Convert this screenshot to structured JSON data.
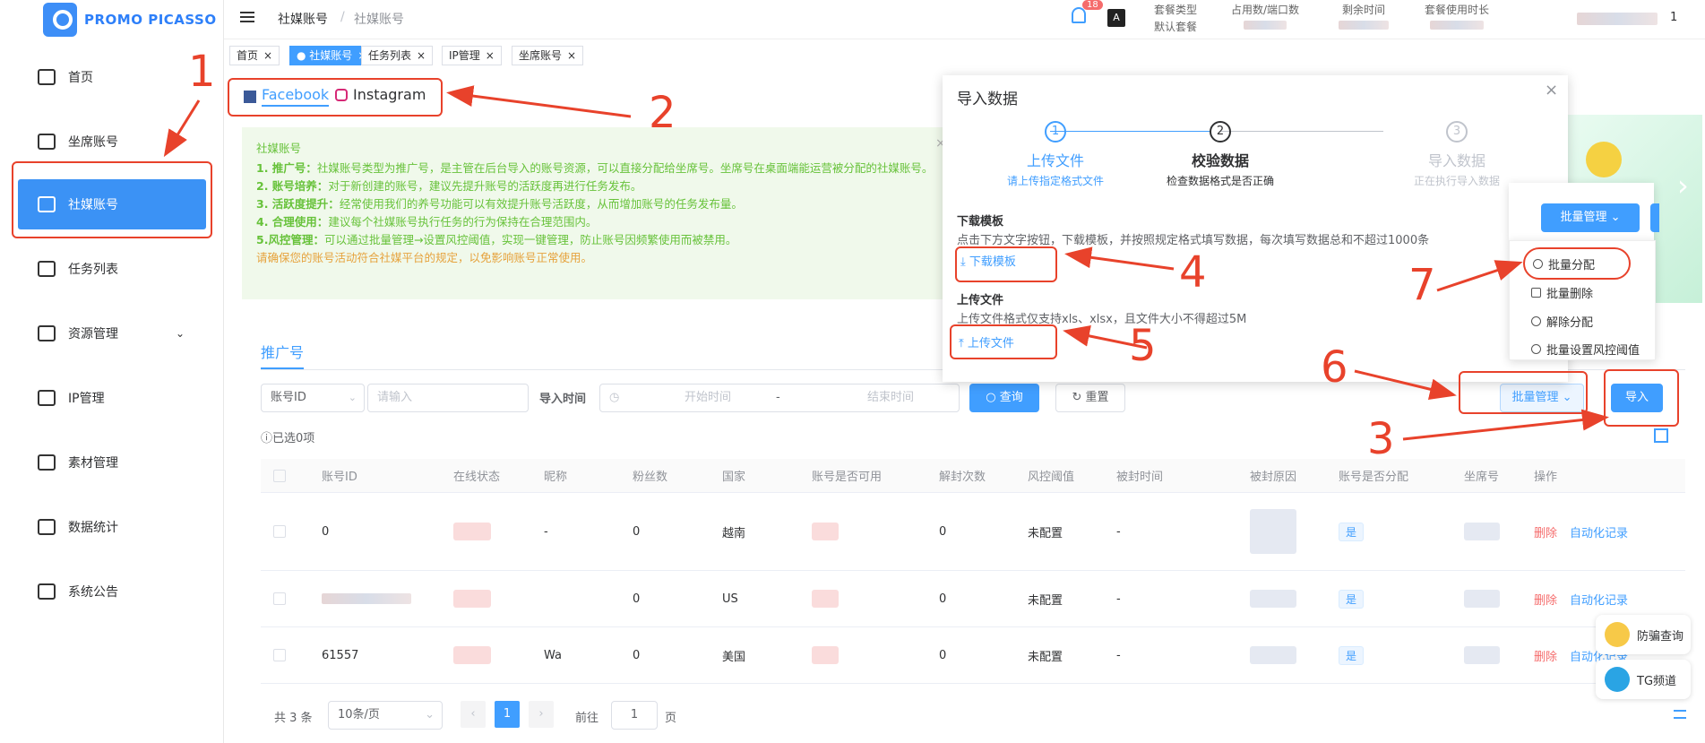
{
  "app": {
    "name": "PROMO PICASSO"
  },
  "sidebar": {
    "items": [
      {
        "label": "首页",
        "icon": "home-icon"
      },
      {
        "label": "坐席账号",
        "icon": "seat-icon"
      },
      {
        "label": "社媒账号",
        "icon": "user-list-icon",
        "active": true
      },
      {
        "label": "任务列表",
        "icon": "task-icon"
      },
      {
        "label": "资源管理",
        "icon": "layers-icon",
        "expandable": true
      },
      {
        "label": "IP管理",
        "icon": "ip-icon"
      },
      {
        "label": "素材管理",
        "icon": "image-icon"
      },
      {
        "label": "数据统计",
        "icon": "chart-icon"
      },
      {
        "label": "系统公告",
        "icon": "bell-icon"
      }
    ]
  },
  "header": {
    "breadcrumb": [
      "社媒账号",
      "社媒账号"
    ],
    "notification_count": "18",
    "info": [
      {
        "label": "套餐类型",
        "value": "默认套餐"
      },
      {
        "label": "占用数/端口数",
        "value": ""
      },
      {
        "label": "剩余时间",
        "value": ""
      },
      {
        "label": "套餐使用时长",
        "value": ""
      }
    ],
    "page_number": "1"
  },
  "tabs": [
    {
      "label": "首页"
    },
    {
      "label": "社媒账号",
      "active": true
    },
    {
      "label": "任务列表"
    },
    {
      "label": "IP管理"
    },
    {
      "label": "坐席账号"
    }
  ],
  "platforms": [
    "Facebook",
    "Instagram"
  ],
  "notice": {
    "title": "社媒账号",
    "lines": [
      {
        "key": "1. 推广号：",
        "text": "社媒账号类型为推广号，是主管在后台导入的账号资源，可以直接分配给坐席号。坐席号在桌面端能运营被分配的社媒账号。"
      },
      {
        "key": "2. 账号培养：",
        "text": "对于新创建的账号，建议先提升账号的活跃度再进行任务发布。"
      },
      {
        "key": "3. 活跃度提升：",
        "text": "经常使用我们的养号功能可以有效提升账号活跃度，从而增加账号的任务发布量。"
      },
      {
        "key": "4. 合理使用：",
        "text": "建议每个社媒账号执行任务的行为保持在合理范围内。"
      },
      {
        "key": "5.风控管理：",
        "text": "可以通过批量管理→设置风控阈值，实现一键管理，防止账号因频繁使用而被禁用。"
      }
    ],
    "warning": "请确保您的账号活动符合社媒平台的规定，以免影响账号正常使用。"
  },
  "subtab": "推广号",
  "filters": {
    "field_select": "账号ID",
    "search_placeholder": "请输入",
    "import_time_label": "导入时间",
    "start_placeholder": "开始时间",
    "range_sep": "-",
    "end_placeholder": "结束时间",
    "query": "查询",
    "reset": "重置",
    "batch": "批量管理",
    "import": "导入",
    "selected": "已选0项"
  },
  "table": {
    "columns": [
      "账号ID",
      "在线状态",
      "昵称",
      "粉丝数",
      "国家",
      "账号是否可用",
      "解封次数",
      "风控阈值",
      "被封时间",
      "被封原因",
      "账号是否分配",
      "坐席号",
      "操作"
    ],
    "rows": [
      {
        "id": "0",
        "nickname": "-",
        "fans": "0",
        "country": "越南",
        "unban": "0",
        "risk": "未配置",
        "ban_time": "-",
        "assigned": "是",
        "delete": "删除",
        "record": "自动化记录"
      },
      {
        "id": "",
        "nickname": "",
        "fans": "0",
        "country": "US",
        "unban": "0",
        "risk": "未配置",
        "ban_time": "-",
        "assigned": "是",
        "delete": "删除",
        "record": "自动化记录"
      },
      {
        "id": "61557",
        "nickname": "Wa",
        "fans": "0",
        "country": "美国",
        "unban": "0",
        "risk": "未配置",
        "ban_time": "-",
        "assigned": "是",
        "delete": "删除",
        "record": "自动化记录"
      }
    ]
  },
  "pagination": {
    "total": "共 3 条",
    "size": "10条/页",
    "current": "1",
    "goto": "前往",
    "goto_value": "1",
    "unit": "页"
  },
  "dialog": {
    "title": "导入数据",
    "steps": [
      {
        "num": "1",
        "title": "上传文件",
        "desc": "请上传指定格式文件"
      },
      {
        "num": "2",
        "title": "校验数据",
        "desc": "检查数据格式是否正确"
      },
      {
        "num": "3",
        "title": "导入数据",
        "desc": "正在执行导入数据"
      }
    ],
    "download_title": "下载模板",
    "download_desc": "点击下方文字按钮，下载模板，并按照规定格式填写数据，每次填写数据总和不超过1000条",
    "download_link": "下载模板",
    "upload_title": "上传文件",
    "upload_desc": "上传文件格式仅支持xls、xlsx，且文件大小不得超过5M",
    "upload_link": "上传文件"
  },
  "dropdown": {
    "button": "批量管理",
    "items": [
      "批量分配",
      "批量删除",
      "解除分配",
      "批量设置风控阈值"
    ]
  },
  "float_buttons": [
    "防骗查询",
    "TG频道"
  ],
  "annotations": [
    "1",
    "2",
    "3",
    "4",
    "5",
    "6",
    "7"
  ],
  "colors": {
    "primary": "#409eff",
    "annotation": "#e8422b",
    "active_nav": "#3b92f5",
    "notice_bg": "#f0f9eb"
  }
}
